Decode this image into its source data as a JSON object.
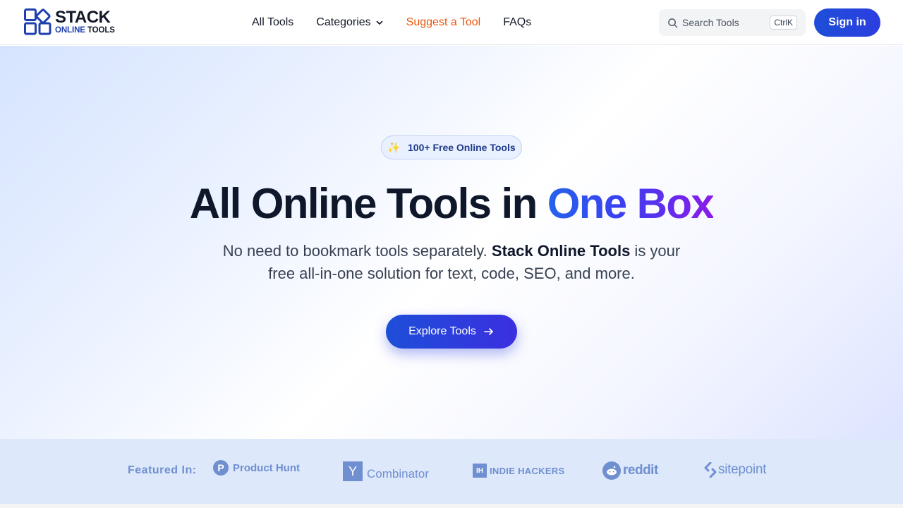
{
  "logo": {
    "line1": "STACK",
    "line2_a": "ONLINE",
    "line2_b": "TOOLS"
  },
  "nav": {
    "items": [
      {
        "label": "All Tools"
      },
      {
        "label": "Categories"
      },
      {
        "label": "Suggest a Tool"
      },
      {
        "label": "FAQs"
      }
    ]
  },
  "search": {
    "placeholder": "Search Tools",
    "shortcut": "CtrlK"
  },
  "header": {
    "signin_label": "Sign in"
  },
  "hero": {
    "badge": "100+ Free Online Tools",
    "title_main": "All Online Tools in ",
    "title_highlight": "One Box",
    "subtitle_a": "No need to bookmark tools separately. ",
    "subtitle_bold": "Stack Online Tools",
    "subtitle_b": " is your free all-in-one solution for text, code, SEO, and more.",
    "cta_label": "Explore Tools"
  },
  "featured": {
    "label": "Featured In:",
    "brands": [
      {
        "name": "Product Hunt",
        "mark": "P"
      },
      {
        "name": "Combinator",
        "mark": "Y"
      },
      {
        "name": "INDIE HACKERS",
        "mark": "IH"
      },
      {
        "name": "reddit"
      },
      {
        "name": "sitepoint"
      }
    ]
  },
  "colors": {
    "primary": "#1d4ed8",
    "accent": "#ea580c",
    "gradient_end": "#8b1bea",
    "featured_brand": "#6f8fd1"
  }
}
